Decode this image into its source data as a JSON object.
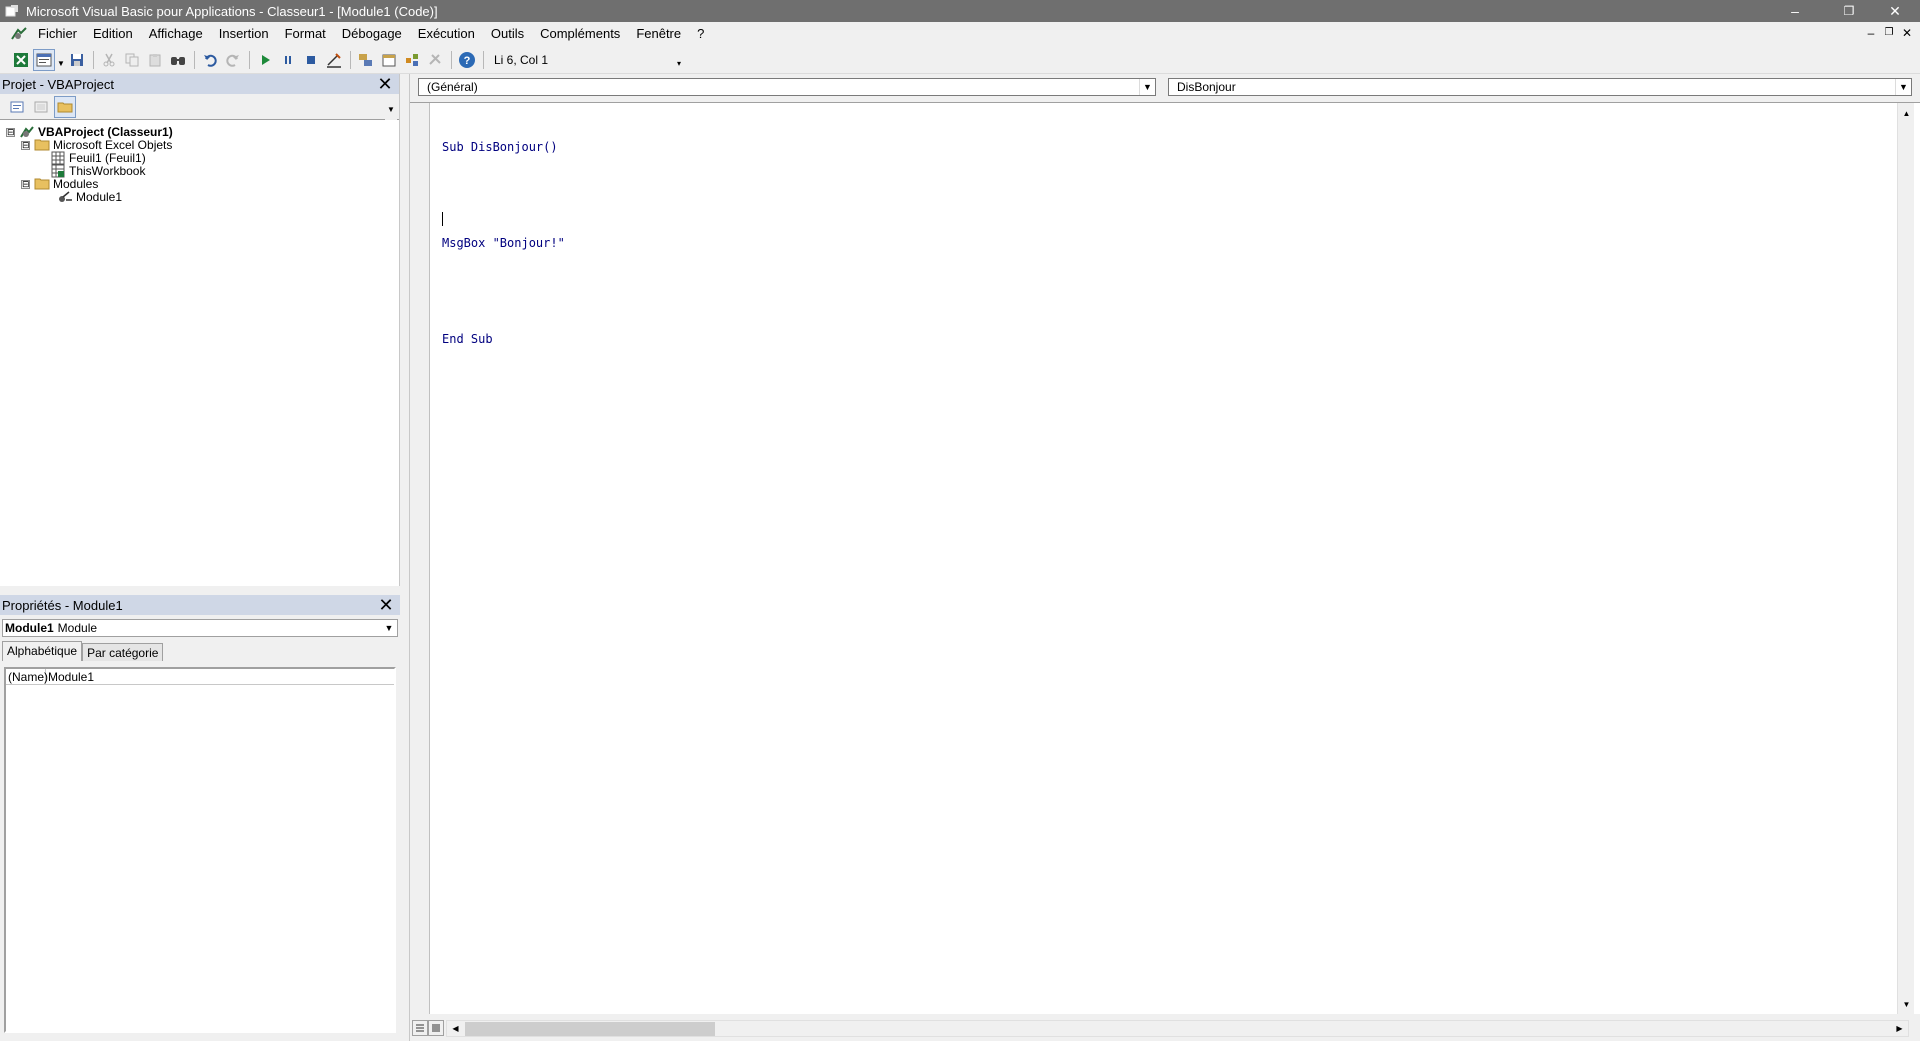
{
  "window": {
    "title": "Microsoft Visual Basic pour Applications - Classeur1 - [Module1 (Code)]",
    "minimize": "–",
    "restore": "❐",
    "close": "✕"
  },
  "menu": {
    "items": [
      "Fichier",
      "Edition",
      "Affichage",
      "Insertion",
      "Format",
      "Débogage",
      "Exécution",
      "Outils",
      "Compléments",
      "Fenêtre",
      "?"
    ],
    "mdi_minimize": "–",
    "mdi_restore": "❐",
    "mdi_close": "✕"
  },
  "toolbar": {
    "position_label": "Li 6, Col 1"
  },
  "project_panel": {
    "title": "Projet - VBAProject",
    "close": "✕",
    "tree": [
      {
        "label": "VBAProject (Classeur1)",
        "bold": true,
        "icon": "vbaproject-icon",
        "expander": "⊟"
      },
      {
        "label": "Microsoft Excel Objets",
        "bold": false,
        "icon": "folder-icon",
        "expander": "⊟"
      },
      {
        "label": "Feuil1 (Feuil1)",
        "bold": false,
        "icon": "worksheet-icon",
        "expander": ""
      },
      {
        "label": "ThisWorkbook",
        "bold": false,
        "icon": "workbook-icon",
        "expander": ""
      },
      {
        "label": "Modules",
        "bold": false,
        "icon": "folder-icon",
        "expander": "⊟"
      },
      {
        "label": "Module1",
        "bold": false,
        "icon": "module-icon",
        "expander": ""
      }
    ]
  },
  "properties_panel": {
    "title": "Propriétés - Module1",
    "close": "✕",
    "object_name": "Module1",
    "object_type": "Module",
    "tabs": [
      "Alphabétique",
      "Par catégorie"
    ],
    "rows": [
      {
        "name": "(Name)",
        "value": "Module1"
      }
    ]
  },
  "code_window": {
    "object_combo": "(Général)",
    "procedure_combo": "DisBonjour",
    "lines": [
      "Sub DisBonjour()",
      "",
      "MsgBox \"Bonjour!\"",
      "",
      "End Sub",
      ""
    ]
  },
  "colors": {
    "titlebar": "#6f6f6f",
    "panel_title": "#cfd7e6",
    "code_keyword": "#00007f"
  }
}
